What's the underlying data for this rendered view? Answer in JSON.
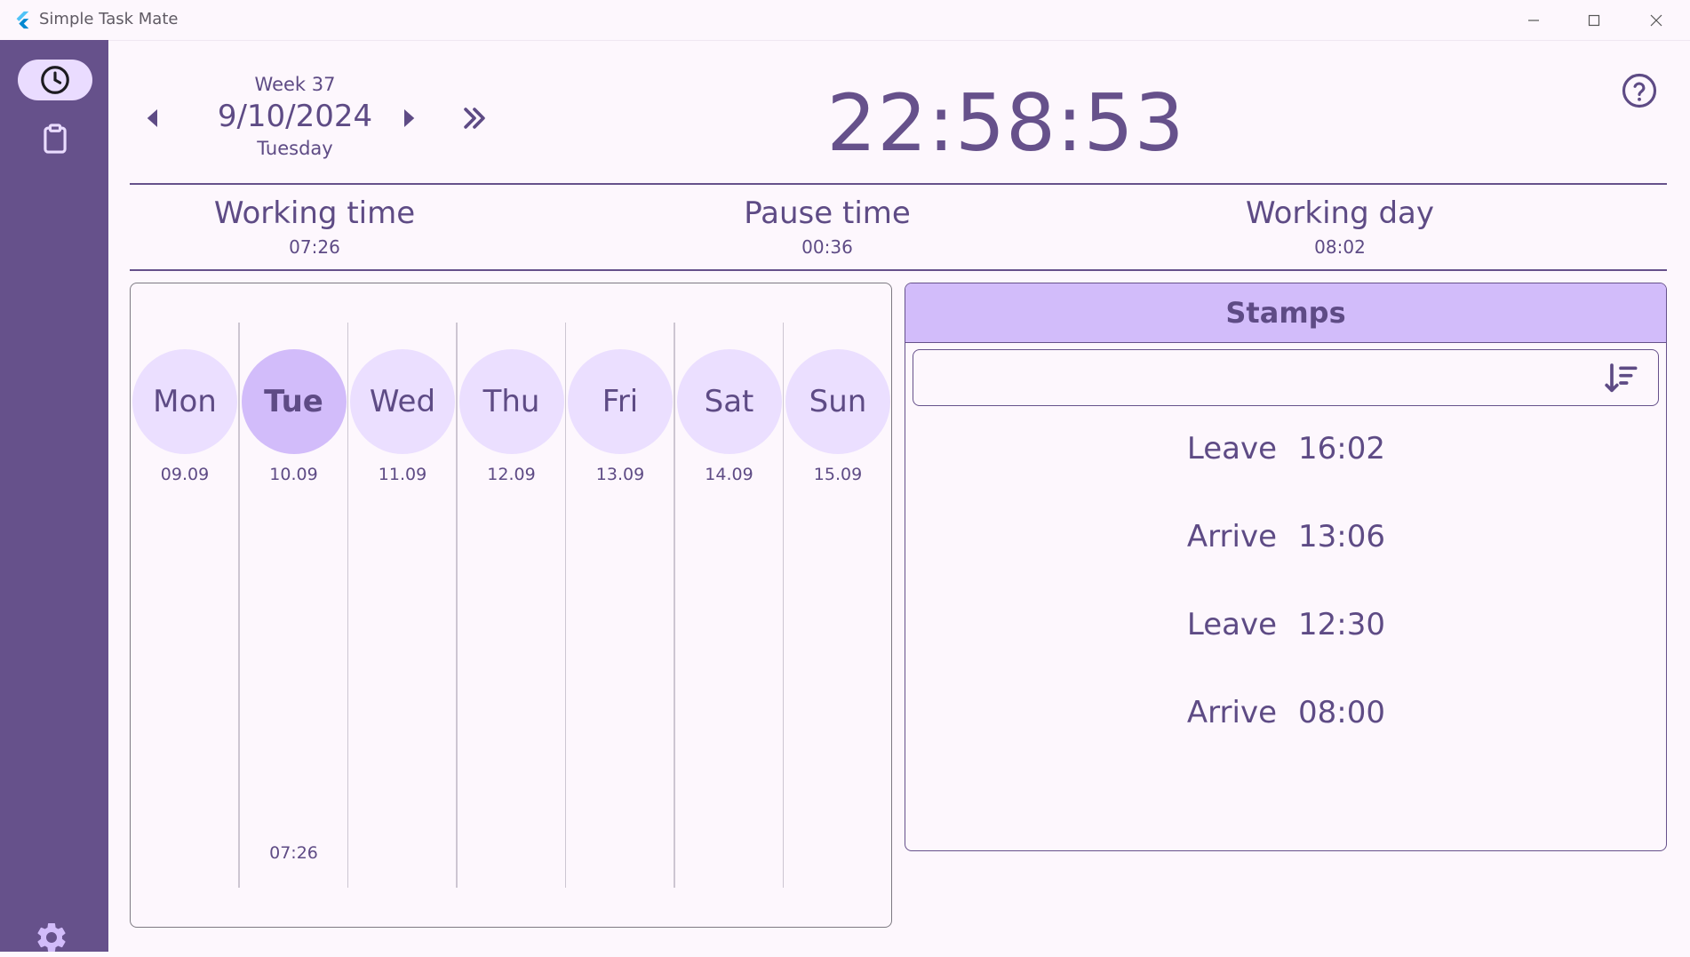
{
  "window": {
    "title": "Simple Task Mate"
  },
  "header": {
    "week": "Week 37",
    "date": "9/10/2024",
    "day": "Tuesday",
    "clock": "22:58:53"
  },
  "stats": [
    {
      "label": "Working time",
      "value": "07:26"
    },
    {
      "label": "Pause time",
      "value": "00:36"
    },
    {
      "label": "Working day",
      "value": "08:02"
    }
  ],
  "week": {
    "days": [
      {
        "name": "Mon",
        "date": "09.09",
        "hours": ""
      },
      {
        "name": "Tue",
        "date": "10.09",
        "hours": "07:26"
      },
      {
        "name": "Wed",
        "date": "11.09",
        "hours": ""
      },
      {
        "name": "Thu",
        "date": "12.09",
        "hours": ""
      },
      {
        "name": "Fri",
        "date": "13.09",
        "hours": ""
      },
      {
        "name": "Sat",
        "date": "14.09",
        "hours": ""
      },
      {
        "name": "Sun",
        "date": "15.09",
        "hours": ""
      }
    ],
    "selected_index": 1
  },
  "stamps": {
    "title": "Stamps",
    "items": [
      {
        "type": "Leave",
        "time": "16:02"
      },
      {
        "type": "Arrive",
        "time": "13:06"
      },
      {
        "type": "Leave",
        "time": "12:30"
      },
      {
        "type": "Arrive",
        "time": "08:00"
      }
    ]
  },
  "icons": {
    "nav_time": "clock-icon",
    "nav_tasks": "clipboard-icon",
    "settings": "gear-icon",
    "help": "help-icon",
    "edit": "edit-icon",
    "sort": "sort-icon"
  },
  "colors": {
    "primary": "#66518b",
    "accent": "#d2bcfa",
    "surface": "#fdf7fd",
    "day_circle": "#ebdfff"
  }
}
